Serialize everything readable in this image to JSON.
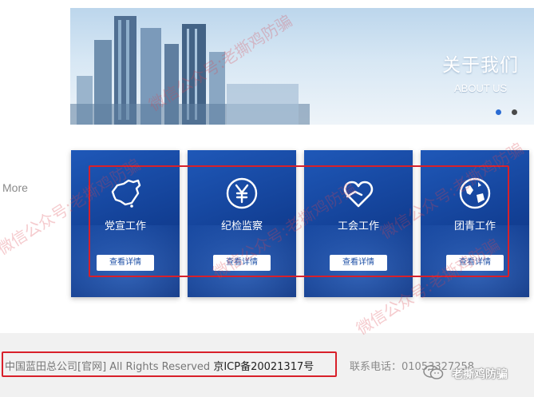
{
  "banner": {
    "title": "关于我们",
    "subtitle": "ABOUT US"
  },
  "more_label": "More",
  "cards": [
    {
      "label": "党宣工作",
      "button": "查看详情",
      "icon": "china-map-icon"
    },
    {
      "label": "纪检监察",
      "button": "查看详情",
      "icon": "yuan-coin-icon"
    },
    {
      "label": "工会工作",
      "button": "查看详情",
      "icon": "heart-hand-icon"
    },
    {
      "label": "团青工作",
      "button": "查看详情",
      "icon": "globe-icon"
    }
  ],
  "footer": {
    "copyright": "中国蓝田总公司[官网] All Rights Reserved ",
    "icp": "京ICP备20021317号",
    "phone": "联系电话：01053327258"
  },
  "watermark": {
    "text": "微信公众号:老撕鸡防骗",
    "account_name": "老撕鸡防骗"
  },
  "colors": {
    "card_blue": "#123f94",
    "highlight_red": "#d8202a",
    "footer_bg": "#f1f1f1"
  }
}
